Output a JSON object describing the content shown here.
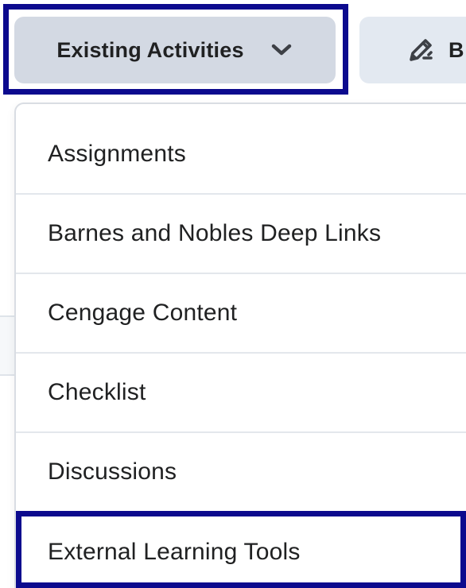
{
  "toolbar": {
    "existing_activities_label": "Existing Activities",
    "second_button_label": "B",
    "chevron_icon": "chevron-down-icon",
    "pencil_icon": "pencil-icon"
  },
  "menu": {
    "items": [
      {
        "label": "Assignments"
      },
      {
        "label": "Barnes and Nobles Deep Links"
      },
      {
        "label": "Cengage Content"
      },
      {
        "label": "Checklist"
      },
      {
        "label": "Discussions"
      },
      {
        "label": "External Learning Tools"
      }
    ],
    "highlighted_item": "External Learning Tools"
  },
  "colors": {
    "highlight_frame": "#0c0a8e",
    "primary_button_bg": "#d3d9e3",
    "secondary_button_bg": "#e3e9f1",
    "text": "#202122",
    "divider": "#e3e7ec"
  }
}
